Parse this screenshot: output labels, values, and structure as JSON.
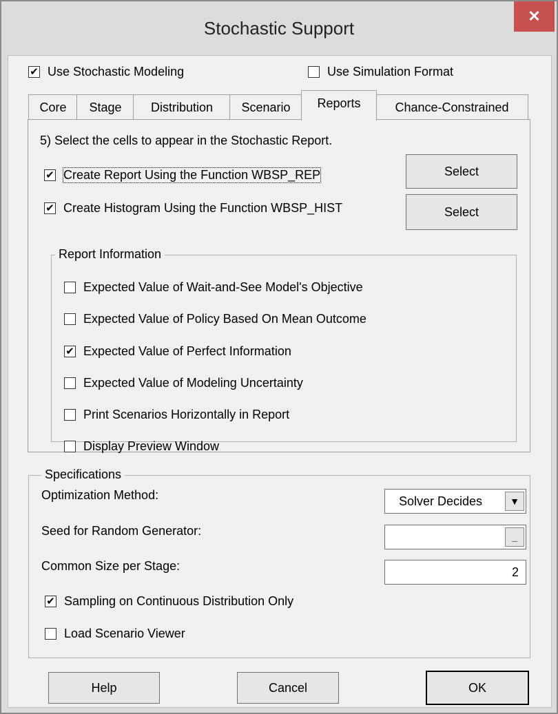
{
  "window": {
    "title": "Stochastic Support",
    "close_label": "✕"
  },
  "top_options": {
    "use_stochastic": {
      "label": "Use Stochastic Modeling",
      "checked": true
    },
    "use_simulation": {
      "label": "Use Simulation Format",
      "checked": false
    }
  },
  "tabs": [
    "Core",
    "Stage",
    "Distribution",
    "Scenario",
    "Reports",
    "Chance-Constrained"
  ],
  "active_tab": "Reports",
  "reports": {
    "instruction": "5) Select the cells to appear in the Stochastic Report.",
    "create_report": {
      "label": "Create Report Using the Function WBSP_REP",
      "checked": true
    },
    "create_histogram": {
      "label": "Create Histogram Using the Function WBSP_HIST",
      "checked": true
    },
    "select_report_label": "Select",
    "select_hist_label": "Select"
  },
  "report_info": {
    "legend": "Report Information",
    "items": [
      {
        "label": "Expected Value of Wait-and-See Model's Objective",
        "checked": false
      },
      {
        "label": "Expected Value of Policy Based On Mean Outcome",
        "checked": false
      },
      {
        "label": "Expected Value of Perfect Information",
        "checked": true
      },
      {
        "label": "Expected Value of Modeling Uncertainty",
        "checked": false
      },
      {
        "label": "Print Scenarios Horizontally in Report",
        "checked": false
      },
      {
        "label": "Display Preview Window",
        "checked": false
      }
    ]
  },
  "specifications": {
    "legend": "Specifications",
    "optimization_method_label": "Optimization Method:",
    "optimization_method_value": "Solver Decides",
    "seed_label": "Seed for Random Generator:",
    "seed_value": "",
    "seed_button": "_",
    "common_size_label": "Common Size per Stage:",
    "common_size_value": "2",
    "sampling": {
      "label": "Sampling on Continuous Distribution Only",
      "checked": true
    },
    "load_viewer": {
      "label": "Load Scenario Viewer",
      "checked": false
    }
  },
  "buttons": {
    "help": "Help",
    "cancel": "Cancel",
    "ok": "OK"
  },
  "icons": {
    "check": "✔",
    "dropdown": "▼"
  },
  "colors": {
    "close_button": "#c75050",
    "title_bar": "#dcdcdc",
    "client": "#f0f0f0"
  }
}
